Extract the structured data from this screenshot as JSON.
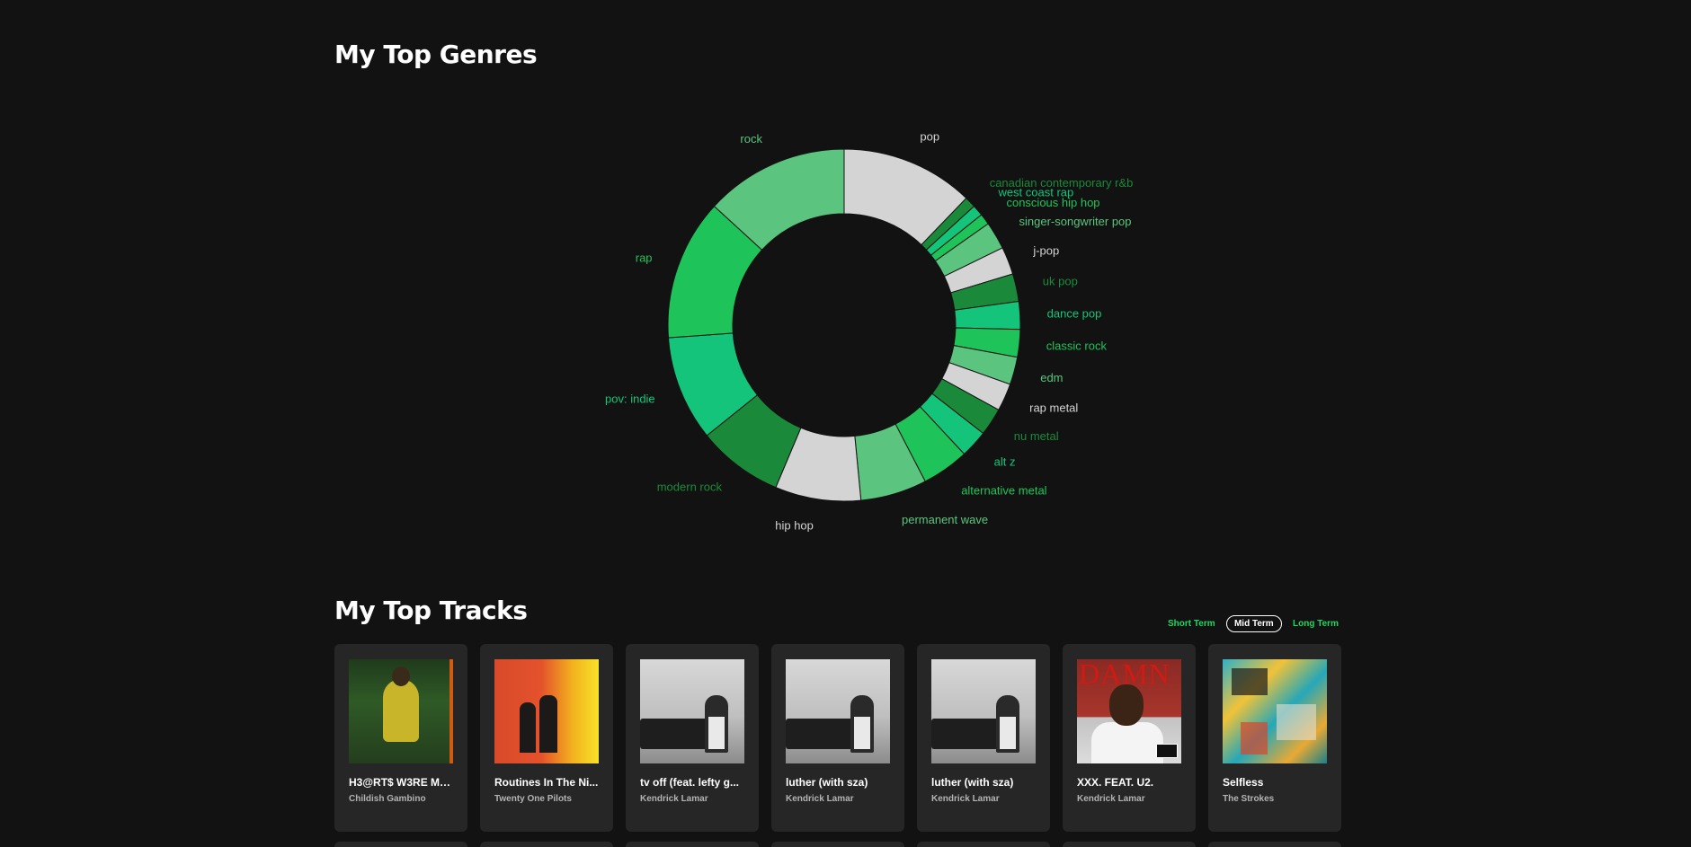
{
  "genres_section": {
    "title": "My Top Genres"
  },
  "chart_data": {
    "type": "pie",
    "title": "",
    "slices": [
      {
        "label": "pop",
        "value": 48,
        "color": "#d4d4d4"
      },
      {
        "label": "canadian contemporary r&b",
        "value": 4,
        "color": "#1a8a3a"
      },
      {
        "label": "west coast rap",
        "value": 4,
        "color": "#14c47a"
      },
      {
        "label": "conscious hip hop",
        "value": 4,
        "color": "#1ec45a"
      },
      {
        "label": "singer-songwriter pop",
        "value": 10,
        "color": "#5bc47e"
      },
      {
        "label": "j-pop",
        "value": 10,
        "color": "#d4d4d4"
      },
      {
        "label": "uk pop",
        "value": 10,
        "color": "#1a8a3a"
      },
      {
        "label": "dance pop",
        "value": 10,
        "color": "#14c47a"
      },
      {
        "label": "classic rock",
        "value": 10,
        "color": "#1ec45a"
      },
      {
        "label": "edm",
        "value": 10,
        "color": "#5bc47e"
      },
      {
        "label": "rap metal",
        "value": 10,
        "color": "#d4d4d4"
      },
      {
        "label": "nu metal",
        "value": 10,
        "color": "#1a8a3a"
      },
      {
        "label": "alt z",
        "value": 10,
        "color": "#14c47a"
      },
      {
        "label": "alternative metal",
        "value": 17,
        "color": "#1ec45a"
      },
      {
        "label": "permanent wave",
        "value": 24,
        "color": "#5bc47e"
      },
      {
        "label": "hip hop",
        "value": 31,
        "color": "#d4d4d4"
      },
      {
        "label": "modern rock",
        "value": 31,
        "color": "#1a8a3a"
      },
      {
        "label": "pov: indie",
        "value": 38,
        "color": "#14c47a"
      },
      {
        "label": "rap",
        "value": 51,
        "color": "#1ec45a"
      },
      {
        "label": "rock",
        "value": 52,
        "color": "#5bc47e"
      }
    ]
  },
  "tracks_section": {
    "title": "My Top Tracks",
    "terms": [
      {
        "label": "Short Term",
        "active": false
      },
      {
        "label": "Mid Term",
        "active": true
      },
      {
        "label": "Long Term",
        "active": false
      }
    ],
    "tracks": [
      {
        "name": "H3@RT$ W3RE M3...",
        "artist": "Childish Gambino",
        "cover": "jungle"
      },
      {
        "name": "Routines In The Ni...",
        "artist": "Twenty One Pilots",
        "cover": "fire"
      },
      {
        "name": "tv off (feat. lefty g...",
        "artist": "Kendrick Lamar",
        "cover": "gnx"
      },
      {
        "name": "luther (with sza)",
        "artist": "Kendrick Lamar",
        "cover": "gnx"
      },
      {
        "name": "luther (with sza)",
        "artist": "Kendrick Lamar",
        "cover": "gnx"
      },
      {
        "name": "XXX. FEAT. U2.",
        "artist": "Kendrick Lamar",
        "cover": "damn"
      },
      {
        "name": "Selfless",
        "artist": "The Strokes",
        "cover": "strokes"
      }
    ],
    "damn_cover_text": "DAMN"
  }
}
